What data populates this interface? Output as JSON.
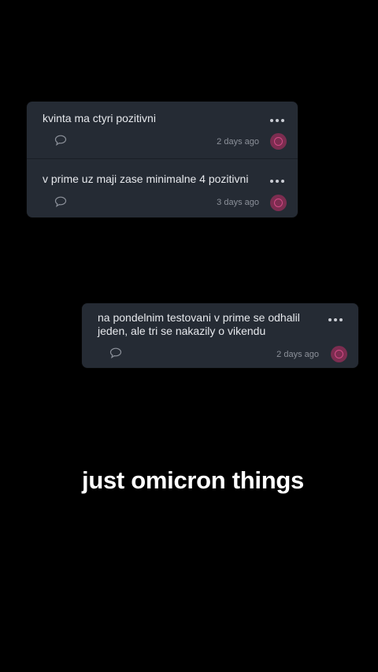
{
  "posts": [
    {
      "text": "kvinta ma ctyri pozitivni",
      "time": "2 days ago",
      "icons": {
        "more": "more-dots-icon",
        "comment": "comment-bubble-icon",
        "avatar": "user-avatar"
      }
    },
    {
      "text": "v prime uz maji zase minimalne 4 pozitivni",
      "time": "3 days ago",
      "icons": {
        "more": "more-dots-icon",
        "comment": "comment-bubble-icon",
        "avatar": "user-avatar"
      }
    },
    {
      "text": "na pondelnim testovani v prime se odhalil jeden, ale tri se nakazily o vikendu",
      "time": "2 days ago",
      "icons": {
        "more": "more-dots-icon",
        "comment": "comment-bubble-icon",
        "avatar": "user-avatar"
      }
    }
  ],
  "caption": "just omicron things",
  "colors": {
    "background": "#000000",
    "card": "#252b34",
    "text": "#e6e8ec",
    "timestamp": "#8c919a",
    "avatar": "#7c2d50",
    "avatar_accent": "#d24a86"
  }
}
